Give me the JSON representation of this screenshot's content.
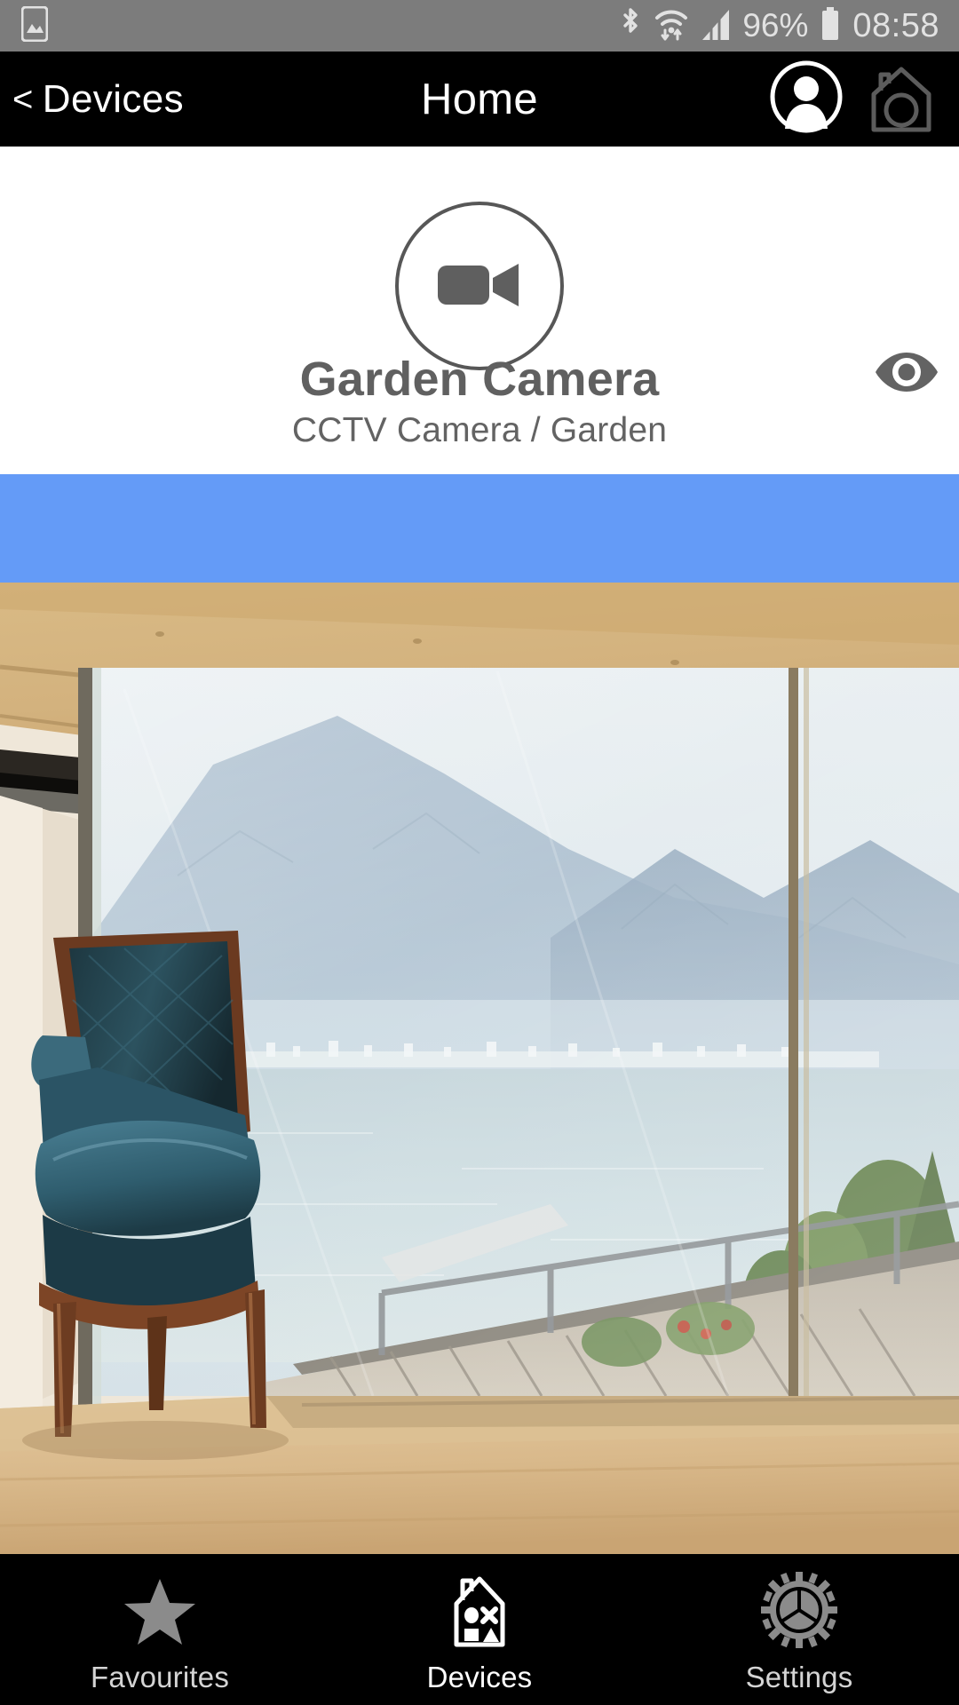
{
  "status_bar": {
    "background": "#7c7c7c",
    "left_icons": [
      {
        "name": "screenshot-capture-icon",
        "label": "screenshot"
      }
    ],
    "right_icons": [
      {
        "name": "bluetooth-icon",
        "label": "bluetooth"
      },
      {
        "name": "wifi-icon",
        "label": "wifi"
      },
      {
        "name": "cellular-signal-icon",
        "label": "signal"
      }
    ],
    "battery_percent": "96%",
    "battery_icon": "battery-full-icon",
    "clock": "08:58"
  },
  "nav_bar": {
    "background": "#000000",
    "back_chevron": "<",
    "back_label": "Devices",
    "title": "Home",
    "profile_icon": "user-avatar-icon",
    "house_icon": "house-camera-icon"
  },
  "device_card": {
    "visibility_icon": "eye-icon",
    "device_type_icon": "video-camera-icon",
    "name": "Garden Camera",
    "subtitle": "CCTV Camera / Garden",
    "prev_arrow": "chevron-left-icon",
    "next_arrow": "chevron-right-icon",
    "accent_color": "#649bf7",
    "text_color": "#606060"
  },
  "stream": {
    "banner_color": "#649bf7",
    "preview_alt": "Living room interior with wooden ceiling, sliding glass doors, blue armchair, wooden deck and lake with mountains beyond"
  },
  "tab_bar": {
    "background": "#000000",
    "tabs": [
      {
        "id": "favourites",
        "label": "Favourites",
        "icon": "star-icon",
        "active": false
      },
      {
        "id": "devices",
        "label": "Devices",
        "icon": "house-shapes-icon",
        "active": true
      },
      {
        "id": "settings",
        "label": "Settings",
        "icon": "gear-icon",
        "active": false
      }
    ]
  }
}
